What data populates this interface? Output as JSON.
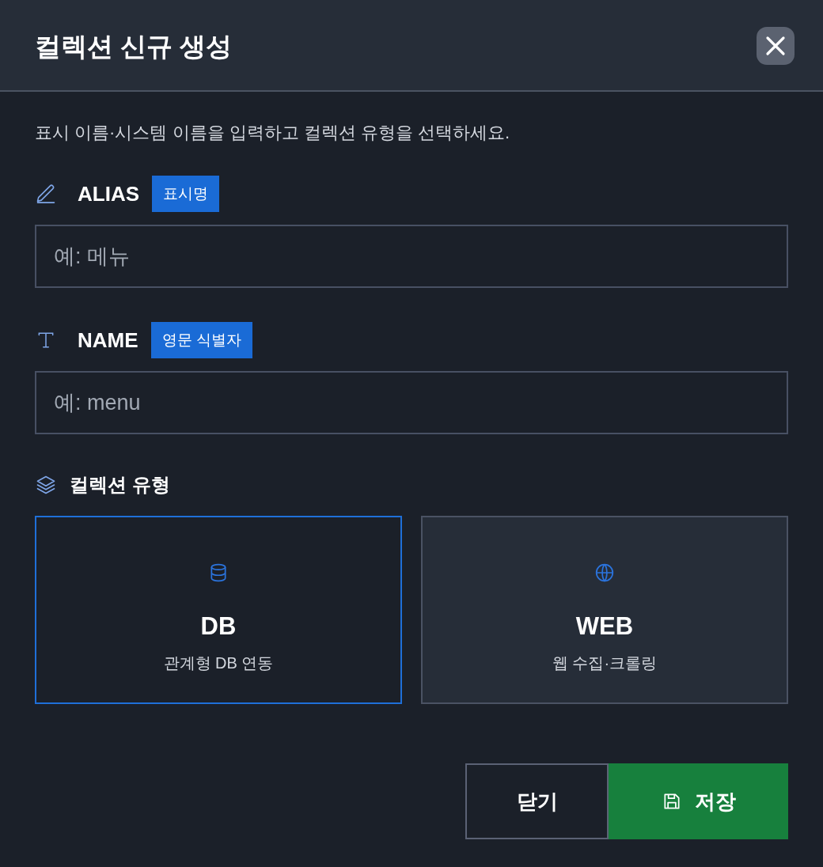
{
  "title": "컬렉션 신규 생성",
  "description": "표시 이름·시스템 이름을 입력하고 컬렉션 유형을 선택하세요.",
  "fields": [
    {
      "label": "ALIAS",
      "badge": "표시명",
      "placeholder": "예: 메뉴"
    },
    {
      "label": "NAME",
      "badge": "영문 식별자",
      "placeholder": "예: menu"
    }
  ],
  "collection_type": {
    "label": "컬렉션 유형",
    "options": [
      {
        "title": "DB",
        "subtitle": "관계형 DB 연동",
        "selected": true
      },
      {
        "title": "WEB",
        "subtitle": "웹 수집·크롤링",
        "selected": false
      }
    ]
  },
  "buttons": [
    {
      "label": "닫기",
      "kind": "secondary"
    },
    {
      "label": "저장",
      "kind": "primary"
    }
  ]
}
